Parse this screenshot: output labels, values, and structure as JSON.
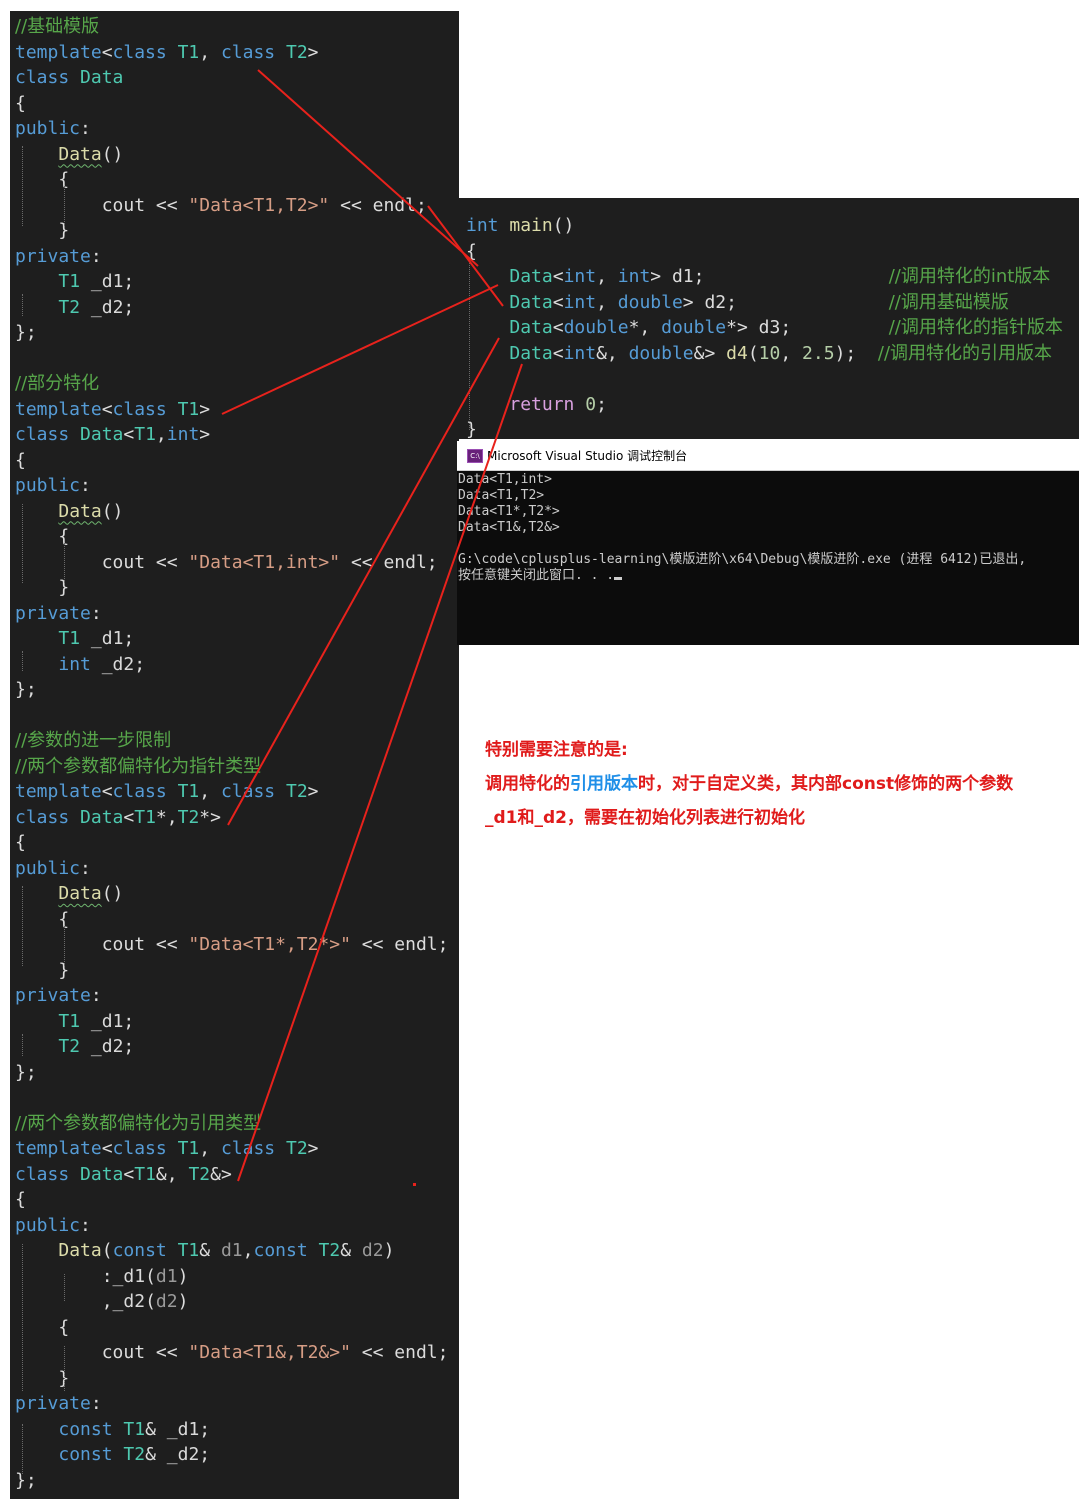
{
  "left_code": [
    [
      {
        "c": "cm",
        "t": "//基础模版"
      }
    ],
    [
      {
        "c": "kw",
        "t": "template"
      },
      {
        "c": "id",
        "t": "<"
      },
      {
        "c": "kw",
        "t": "class"
      },
      {
        "c": "id",
        "t": " "
      },
      {
        "c": "typ",
        "t": "T1"
      },
      {
        "c": "id",
        "t": ", "
      },
      {
        "c": "kw",
        "t": "class"
      },
      {
        "c": "id",
        "t": " "
      },
      {
        "c": "typ",
        "t": "T2"
      },
      {
        "c": "id",
        "t": ">"
      }
    ],
    [
      {
        "c": "kw",
        "t": "class"
      },
      {
        "c": "id",
        "t": " "
      },
      {
        "c": "typ",
        "t": "Data"
      }
    ],
    [
      {
        "c": "id",
        "t": "{"
      }
    ],
    [
      {
        "c": "kw",
        "t": "public"
      },
      {
        "c": "id",
        "t": ":"
      }
    ],
    [
      {
        "c": "id",
        "t": "    "
      },
      {
        "c": "fn-sq",
        "t": "Data"
      },
      {
        "c": "id",
        "t": "()"
      }
    ],
    [
      {
        "c": "id",
        "t": "    {"
      }
    ],
    [
      {
        "c": "id",
        "t": "        cout << "
      },
      {
        "c": "str",
        "t": "\"Data<T1,T2>\""
      },
      {
        "c": "id",
        "t": " << endl;"
      }
    ],
    [
      {
        "c": "id",
        "t": "    }"
      }
    ],
    [
      {
        "c": "kw",
        "t": "private"
      },
      {
        "c": "id",
        "t": ":"
      }
    ],
    [
      {
        "c": "id",
        "t": "    "
      },
      {
        "c": "typ",
        "t": "T1"
      },
      {
        "c": "id",
        "t": " "
      },
      {
        "c": "mem",
        "t": "_d1"
      },
      {
        "c": "id",
        "t": ";"
      }
    ],
    [
      {
        "c": "id",
        "t": "    "
      },
      {
        "c": "typ",
        "t": "T2"
      },
      {
        "c": "id",
        "t": " "
      },
      {
        "c": "mem",
        "t": "_d2"
      },
      {
        "c": "id",
        "t": ";"
      }
    ],
    [
      {
        "c": "id",
        "t": "};"
      }
    ],
    [],
    [
      {
        "c": "cm",
        "t": "//部分特化"
      }
    ],
    [
      {
        "c": "kw",
        "t": "template"
      },
      {
        "c": "id",
        "t": "<"
      },
      {
        "c": "kw",
        "t": "class"
      },
      {
        "c": "id",
        "t": " "
      },
      {
        "c": "typ",
        "t": "T1"
      },
      {
        "c": "id",
        "t": ">"
      }
    ],
    [
      {
        "c": "kw",
        "t": "class"
      },
      {
        "c": "id",
        "t": " "
      },
      {
        "c": "typ",
        "t": "Data"
      },
      {
        "c": "id",
        "t": "<"
      },
      {
        "c": "typ",
        "t": "T1"
      },
      {
        "c": "id",
        "t": ","
      },
      {
        "c": "kw",
        "t": "int"
      },
      {
        "c": "id",
        "t": ">"
      }
    ],
    [
      {
        "c": "id",
        "t": "{"
      }
    ],
    [
      {
        "c": "kw",
        "t": "public"
      },
      {
        "c": "id",
        "t": ":"
      }
    ],
    [
      {
        "c": "id",
        "t": "    "
      },
      {
        "c": "fn-sq",
        "t": "Data"
      },
      {
        "c": "id",
        "t": "()"
      }
    ],
    [
      {
        "c": "id",
        "t": "    {"
      }
    ],
    [
      {
        "c": "id",
        "t": "        cout << "
      },
      {
        "c": "str",
        "t": "\"Data<T1,int>\""
      },
      {
        "c": "id",
        "t": " << endl;"
      }
    ],
    [
      {
        "c": "id",
        "t": "    }"
      }
    ],
    [
      {
        "c": "kw",
        "t": "private"
      },
      {
        "c": "id",
        "t": ":"
      }
    ],
    [
      {
        "c": "id",
        "t": "    "
      },
      {
        "c": "typ",
        "t": "T1"
      },
      {
        "c": "id",
        "t": " "
      },
      {
        "c": "mem",
        "t": "_d1"
      },
      {
        "c": "id",
        "t": ";"
      }
    ],
    [
      {
        "c": "id",
        "t": "    "
      },
      {
        "c": "kw",
        "t": "int"
      },
      {
        "c": "id",
        "t": " "
      },
      {
        "c": "mem",
        "t": "_d2"
      },
      {
        "c": "id",
        "t": ";"
      }
    ],
    [
      {
        "c": "id",
        "t": "};"
      }
    ],
    [],
    [
      {
        "c": "cm",
        "t": "//参数的进一步限制"
      }
    ],
    [
      {
        "c": "cm",
        "t": "//两个参数都偏特化为指针类型"
      }
    ],
    [
      {
        "c": "kw",
        "t": "template"
      },
      {
        "c": "id",
        "t": "<"
      },
      {
        "c": "kw",
        "t": "class"
      },
      {
        "c": "id",
        "t": " "
      },
      {
        "c": "typ",
        "t": "T1"
      },
      {
        "c": "id",
        "t": ", "
      },
      {
        "c": "kw",
        "t": "class"
      },
      {
        "c": "id",
        "t": " "
      },
      {
        "c": "typ",
        "t": "T2"
      },
      {
        "c": "id",
        "t": ">"
      }
    ],
    [
      {
        "c": "kw",
        "t": "class"
      },
      {
        "c": "id",
        "t": " "
      },
      {
        "c": "typ",
        "t": "Data"
      },
      {
        "c": "id",
        "t": "<"
      },
      {
        "c": "typ",
        "t": "T1"
      },
      {
        "c": "id",
        "t": "*,"
      },
      {
        "c": "typ",
        "t": "T2"
      },
      {
        "c": "id",
        "t": "*>"
      }
    ],
    [
      {
        "c": "id",
        "t": "{"
      }
    ],
    [
      {
        "c": "kw",
        "t": "public"
      },
      {
        "c": "id",
        "t": ":"
      }
    ],
    [
      {
        "c": "id",
        "t": "    "
      },
      {
        "c": "fn-sq",
        "t": "Data"
      },
      {
        "c": "id",
        "t": "()"
      }
    ],
    [
      {
        "c": "id",
        "t": "    {"
      }
    ],
    [
      {
        "c": "id",
        "t": "        cout << "
      },
      {
        "c": "str",
        "t": "\"Data<T1*,T2*>\""
      },
      {
        "c": "id",
        "t": " << endl;"
      }
    ],
    [
      {
        "c": "id",
        "t": "    }"
      }
    ],
    [
      {
        "c": "kw",
        "t": "private"
      },
      {
        "c": "id",
        "t": ":"
      }
    ],
    [
      {
        "c": "id",
        "t": "    "
      },
      {
        "c": "typ",
        "t": "T1"
      },
      {
        "c": "id",
        "t": " "
      },
      {
        "c": "mem",
        "t": "_d1"
      },
      {
        "c": "id",
        "t": ";"
      }
    ],
    [
      {
        "c": "id",
        "t": "    "
      },
      {
        "c": "typ",
        "t": "T2"
      },
      {
        "c": "id",
        "t": " "
      },
      {
        "c": "mem",
        "t": "_d2"
      },
      {
        "c": "id",
        "t": ";"
      }
    ],
    [
      {
        "c": "id",
        "t": "};"
      }
    ],
    [],
    [
      {
        "c": "cm",
        "t": "//两个参数都偏特化为引用类型"
      }
    ],
    [
      {
        "c": "kw",
        "t": "template"
      },
      {
        "c": "id",
        "t": "<"
      },
      {
        "c": "kw",
        "t": "class"
      },
      {
        "c": "id",
        "t": " "
      },
      {
        "c": "typ",
        "t": "T1"
      },
      {
        "c": "id",
        "t": ", "
      },
      {
        "c": "kw",
        "t": "class"
      },
      {
        "c": "id",
        "t": " "
      },
      {
        "c": "typ",
        "t": "T2"
      },
      {
        "c": "id",
        "t": ">"
      }
    ],
    [
      {
        "c": "kw",
        "t": "class"
      },
      {
        "c": "id",
        "t": " "
      },
      {
        "c": "typ",
        "t": "Data"
      },
      {
        "c": "id",
        "t": "<"
      },
      {
        "c": "typ",
        "t": "T1"
      },
      {
        "c": "id",
        "t": "&, "
      },
      {
        "c": "typ",
        "t": "T2"
      },
      {
        "c": "id",
        "t": "&>"
      }
    ],
    [
      {
        "c": "id",
        "t": "{"
      }
    ],
    [
      {
        "c": "kw",
        "t": "public"
      },
      {
        "c": "id",
        "t": ":"
      }
    ],
    [
      {
        "c": "id",
        "t": "    "
      },
      {
        "c": "fn",
        "t": "Data"
      },
      {
        "c": "id",
        "t": "("
      },
      {
        "c": "kw",
        "t": "const"
      },
      {
        "c": "id",
        "t": " "
      },
      {
        "c": "typ",
        "t": "T1"
      },
      {
        "c": "id",
        "t": "& "
      },
      {
        "c": "par",
        "t": "d1"
      },
      {
        "c": "id",
        "t": ","
      },
      {
        "c": "kw",
        "t": "const"
      },
      {
        "c": "id",
        "t": " "
      },
      {
        "c": "typ",
        "t": "T2"
      },
      {
        "c": "id",
        "t": "& "
      },
      {
        "c": "par",
        "t": "d2"
      },
      {
        "c": "id",
        "t": ")"
      }
    ],
    [
      {
        "c": "id",
        "t": "        :"
      },
      {
        "c": "mem",
        "t": "_d1"
      },
      {
        "c": "id",
        "t": "("
      },
      {
        "c": "par",
        "t": "d1"
      },
      {
        "c": "id",
        "t": ")"
      }
    ],
    [
      {
        "c": "id",
        "t": "        ,"
      },
      {
        "c": "mem",
        "t": "_d2"
      },
      {
        "c": "id",
        "t": "("
      },
      {
        "c": "par",
        "t": "d2"
      },
      {
        "c": "id",
        "t": ")"
      }
    ],
    [
      {
        "c": "id",
        "t": "    {"
      }
    ],
    [
      {
        "c": "id",
        "t": "        cout << "
      },
      {
        "c": "str",
        "t": "\"Data<T1&,T2&>\""
      },
      {
        "c": "id",
        "t": " << endl;"
      }
    ],
    [
      {
        "c": "id",
        "t": "    }"
      }
    ],
    [
      {
        "c": "kw",
        "t": "private"
      },
      {
        "c": "id",
        "t": ":"
      }
    ],
    [
      {
        "c": "id",
        "t": "    "
      },
      {
        "c": "kw",
        "t": "const"
      },
      {
        "c": "id",
        "t": " "
      },
      {
        "c": "typ",
        "t": "T1"
      },
      {
        "c": "id",
        "t": "& "
      },
      {
        "c": "mem",
        "t": "_d1"
      },
      {
        "c": "id",
        "t": ";"
      }
    ],
    [
      {
        "c": "id",
        "t": "    "
      },
      {
        "c": "kw",
        "t": "const"
      },
      {
        "c": "id",
        "t": " "
      },
      {
        "c": "typ",
        "t": "T2"
      },
      {
        "c": "id",
        "t": "& "
      },
      {
        "c": "mem",
        "t": "_d2"
      },
      {
        "c": "id",
        "t": ";"
      }
    ],
    [
      {
        "c": "id",
        "t": "};"
      }
    ]
  ],
  "main_code": [
    [
      {
        "c": "kw",
        "t": "int"
      },
      {
        "c": "id",
        "t": " "
      },
      {
        "c": "fn",
        "t": "main"
      },
      {
        "c": "id",
        "t": "()"
      }
    ],
    [
      {
        "c": "id",
        "t": "{"
      }
    ],
    [
      {
        "c": "id",
        "t": "    "
      },
      {
        "c": "typ",
        "t": "Data"
      },
      {
        "c": "id",
        "t": "<"
      },
      {
        "c": "kw",
        "t": "int"
      },
      {
        "c": "id",
        "t": ", "
      },
      {
        "c": "kw",
        "t": "int"
      },
      {
        "c": "id",
        "t": "> d1;                 "
      },
      {
        "c": "cm",
        "t": "//调用特化的int版本"
      }
    ],
    [
      {
        "c": "id",
        "t": "    "
      },
      {
        "c": "typ",
        "t": "Data"
      },
      {
        "c": "id",
        "t": "<"
      },
      {
        "c": "kw",
        "t": "int"
      },
      {
        "c": "id",
        "t": ", "
      },
      {
        "c": "kw",
        "t": "double"
      },
      {
        "c": "id",
        "t": "> d2;              "
      },
      {
        "c": "cm",
        "t": "//调用基础模版"
      }
    ],
    [
      {
        "c": "id",
        "t": "    "
      },
      {
        "c": "typ",
        "t": "Data"
      },
      {
        "c": "id",
        "t": "<"
      },
      {
        "c": "kw",
        "t": "double"
      },
      {
        "c": "id",
        "t": "*, "
      },
      {
        "c": "kw",
        "t": "double"
      },
      {
        "c": "id",
        "t": "*> d3;         "
      },
      {
        "c": "cm",
        "t": "//调用特化的指针版本"
      }
    ],
    [
      {
        "c": "id",
        "t": "    "
      },
      {
        "c": "typ",
        "t": "Data"
      },
      {
        "c": "id",
        "t": "<"
      },
      {
        "c": "kw",
        "t": "int"
      },
      {
        "c": "id",
        "t": "&, "
      },
      {
        "c": "kw",
        "t": "double"
      },
      {
        "c": "id",
        "t": "&> "
      },
      {
        "c": "fn",
        "t": "d4"
      },
      {
        "c": "id",
        "t": "("
      },
      {
        "c": "num",
        "t": "10"
      },
      {
        "c": "id",
        "t": ", "
      },
      {
        "c": "num",
        "t": "2.5"
      },
      {
        "c": "id",
        "t": ");  "
      },
      {
        "c": "cm",
        "t": "//调用特化的引用版本"
      }
    ],
    [],
    [
      {
        "c": "id",
        "t": "    "
      },
      {
        "c": "kw2",
        "t": "return"
      },
      {
        "c": "id",
        "t": " "
      },
      {
        "c": "num",
        "t": "0"
      },
      {
        "c": "id",
        "t": ";"
      }
    ],
    [
      {
        "c": "id",
        "t": "}"
      }
    ]
  ],
  "console": {
    "title": "Microsoft Visual Studio 调试控制台",
    "icon": "vs-console-icon",
    "lines": [
      "Data<T1,int>",
      "Data<T1,T2>",
      "Data<T1*,T2*>",
      "Data<T1&,T2&>",
      "",
      "G:\\code\\cplusplus-learning\\模版进阶\\x64\\Debug\\模版进阶.exe (进程 6412)已退出,",
      "按任意键关闭此窗口. . ."
    ]
  },
  "note": {
    "line1": "特别需要注意的是:",
    "line2_a": "调用特化的",
    "line2_b": "引用版本",
    "line2_c": "时，对于自定义类，其内部const修饰的两个参数",
    "line3": "_d1和_d2，需要在初始化列表进行初始化"
  },
  "colors": {
    "editor_bg": "#1e1e1e",
    "keyword": "#569cd6",
    "type": "#4ec9b0",
    "comment": "#57a64a",
    "string": "#d69d85",
    "annotation_red": "#e01b1b",
    "annotation_blue": "#1f8fe8",
    "arrow_red": "#e8221c"
  }
}
